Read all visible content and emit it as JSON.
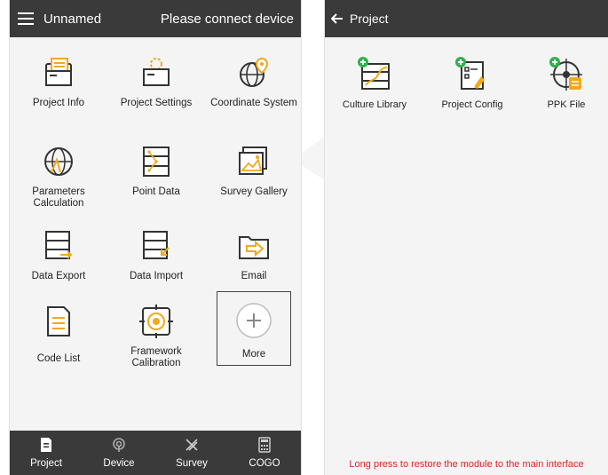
{
  "left": {
    "topbar": {
      "title": "Unnamed",
      "status": "Please connect device"
    },
    "tiles": [
      {
        "label": "Project Info",
        "icon": "folder-doc-icon"
      },
      {
        "label": "Project Settings",
        "icon": "folder-gear-icon"
      },
      {
        "label": "Coordinate System",
        "icon": "globe-pin-icon"
      },
      {
        "label": "Parameters\nCalculation",
        "icon": "globe-compass-icon"
      },
      {
        "label": "Point Data",
        "icon": "database-icon"
      },
      {
        "label": "Survey Gallery",
        "icon": "gallery-icon"
      },
      {
        "label": "Data Export",
        "icon": "export-icon"
      },
      {
        "label": "Data Import",
        "icon": "import-icon"
      },
      {
        "label": "Email",
        "icon": "email-folder-icon"
      },
      {
        "label": "Code List",
        "icon": "code-list-icon"
      },
      {
        "label": "Framework\nCalibration",
        "icon": "target-calibration-icon"
      },
      {
        "label": "More",
        "icon": "plus-circle-icon"
      }
    ],
    "nav": [
      {
        "label": "Project",
        "icon": "project-icon"
      },
      {
        "label": "Device",
        "icon": "device-icon"
      },
      {
        "label": "Survey",
        "icon": "survey-icon"
      },
      {
        "label": "COGO",
        "icon": "cogo-icon"
      }
    ]
  },
  "right": {
    "topbar": {
      "title": "Project"
    },
    "tiles": [
      {
        "label": "Culture Library",
        "icon": "culture-library-icon"
      },
      {
        "label": "Project Config",
        "icon": "project-config-icon"
      },
      {
        "label": "PPK File",
        "icon": "ppk-file-icon"
      }
    ],
    "hint": "Long press to restore the module to the main interface"
  },
  "colors": {
    "accent": "#f0a91c",
    "bar": "#3a3a3a",
    "hint": "#e02020",
    "add_badge": "#2db34a"
  }
}
